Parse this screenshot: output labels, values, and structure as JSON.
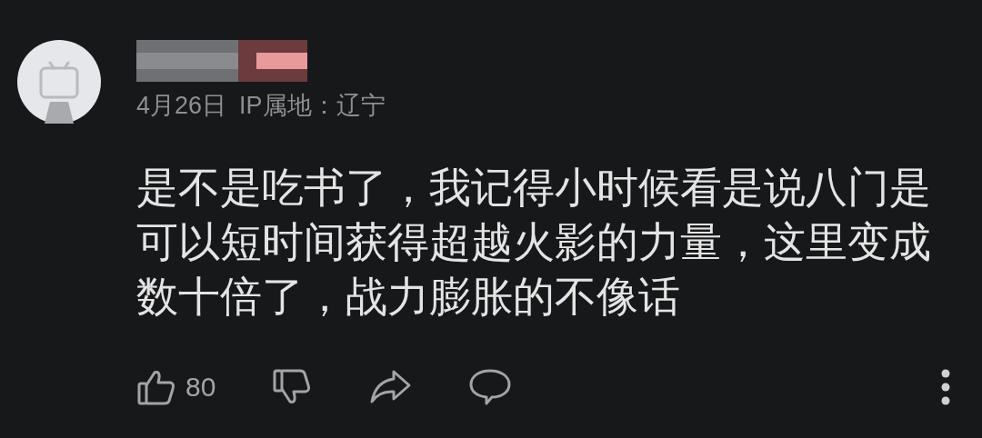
{
  "comment": {
    "date": "4月26日",
    "ip_location": "IP属地：辽宁",
    "text": "是不是吃书了，我记得小时候看是说八门是可以短时间获得超越火影的力量，这里变成数十倍了，战力膨胀的不像话"
  },
  "actions": {
    "like_count": "80"
  }
}
